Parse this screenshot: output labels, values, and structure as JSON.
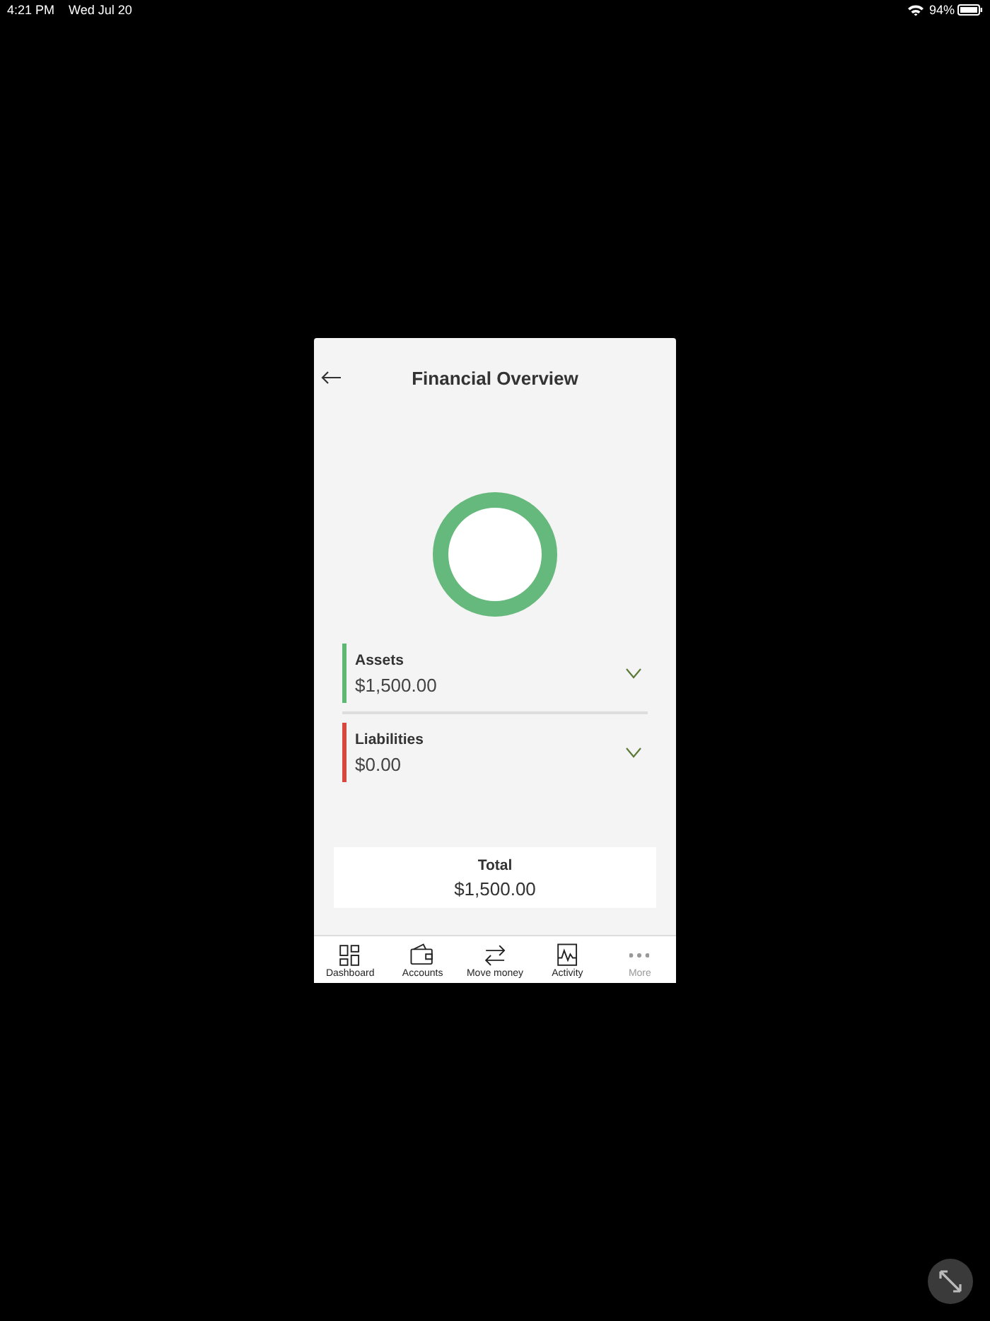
{
  "status_bar": {
    "time": "4:21 PM",
    "date": "Wed Jul 20",
    "battery": "94%"
  },
  "header": {
    "title": "Financial Overview"
  },
  "categories": [
    {
      "label": "Assets",
      "amount": "$1,500.00",
      "color": "#5cb873",
      "expanded": false
    },
    {
      "label": "Liabilities",
      "amount": "$0.00",
      "color": "#d9463f",
      "expanded": false
    }
  ],
  "total": {
    "label": "Total",
    "amount": "$1,500.00"
  },
  "nav": [
    {
      "kind": "dashboard",
      "label": "Dashboard",
      "disabled": false
    },
    {
      "kind": "wallet",
      "label": "Accounts",
      "disabled": false
    },
    {
      "kind": "transfer",
      "label": "Move money",
      "disabled": false
    },
    {
      "kind": "activity",
      "label": "Activity",
      "disabled": false
    },
    {
      "kind": "more",
      "label": "More",
      "disabled": true
    }
  ]
}
